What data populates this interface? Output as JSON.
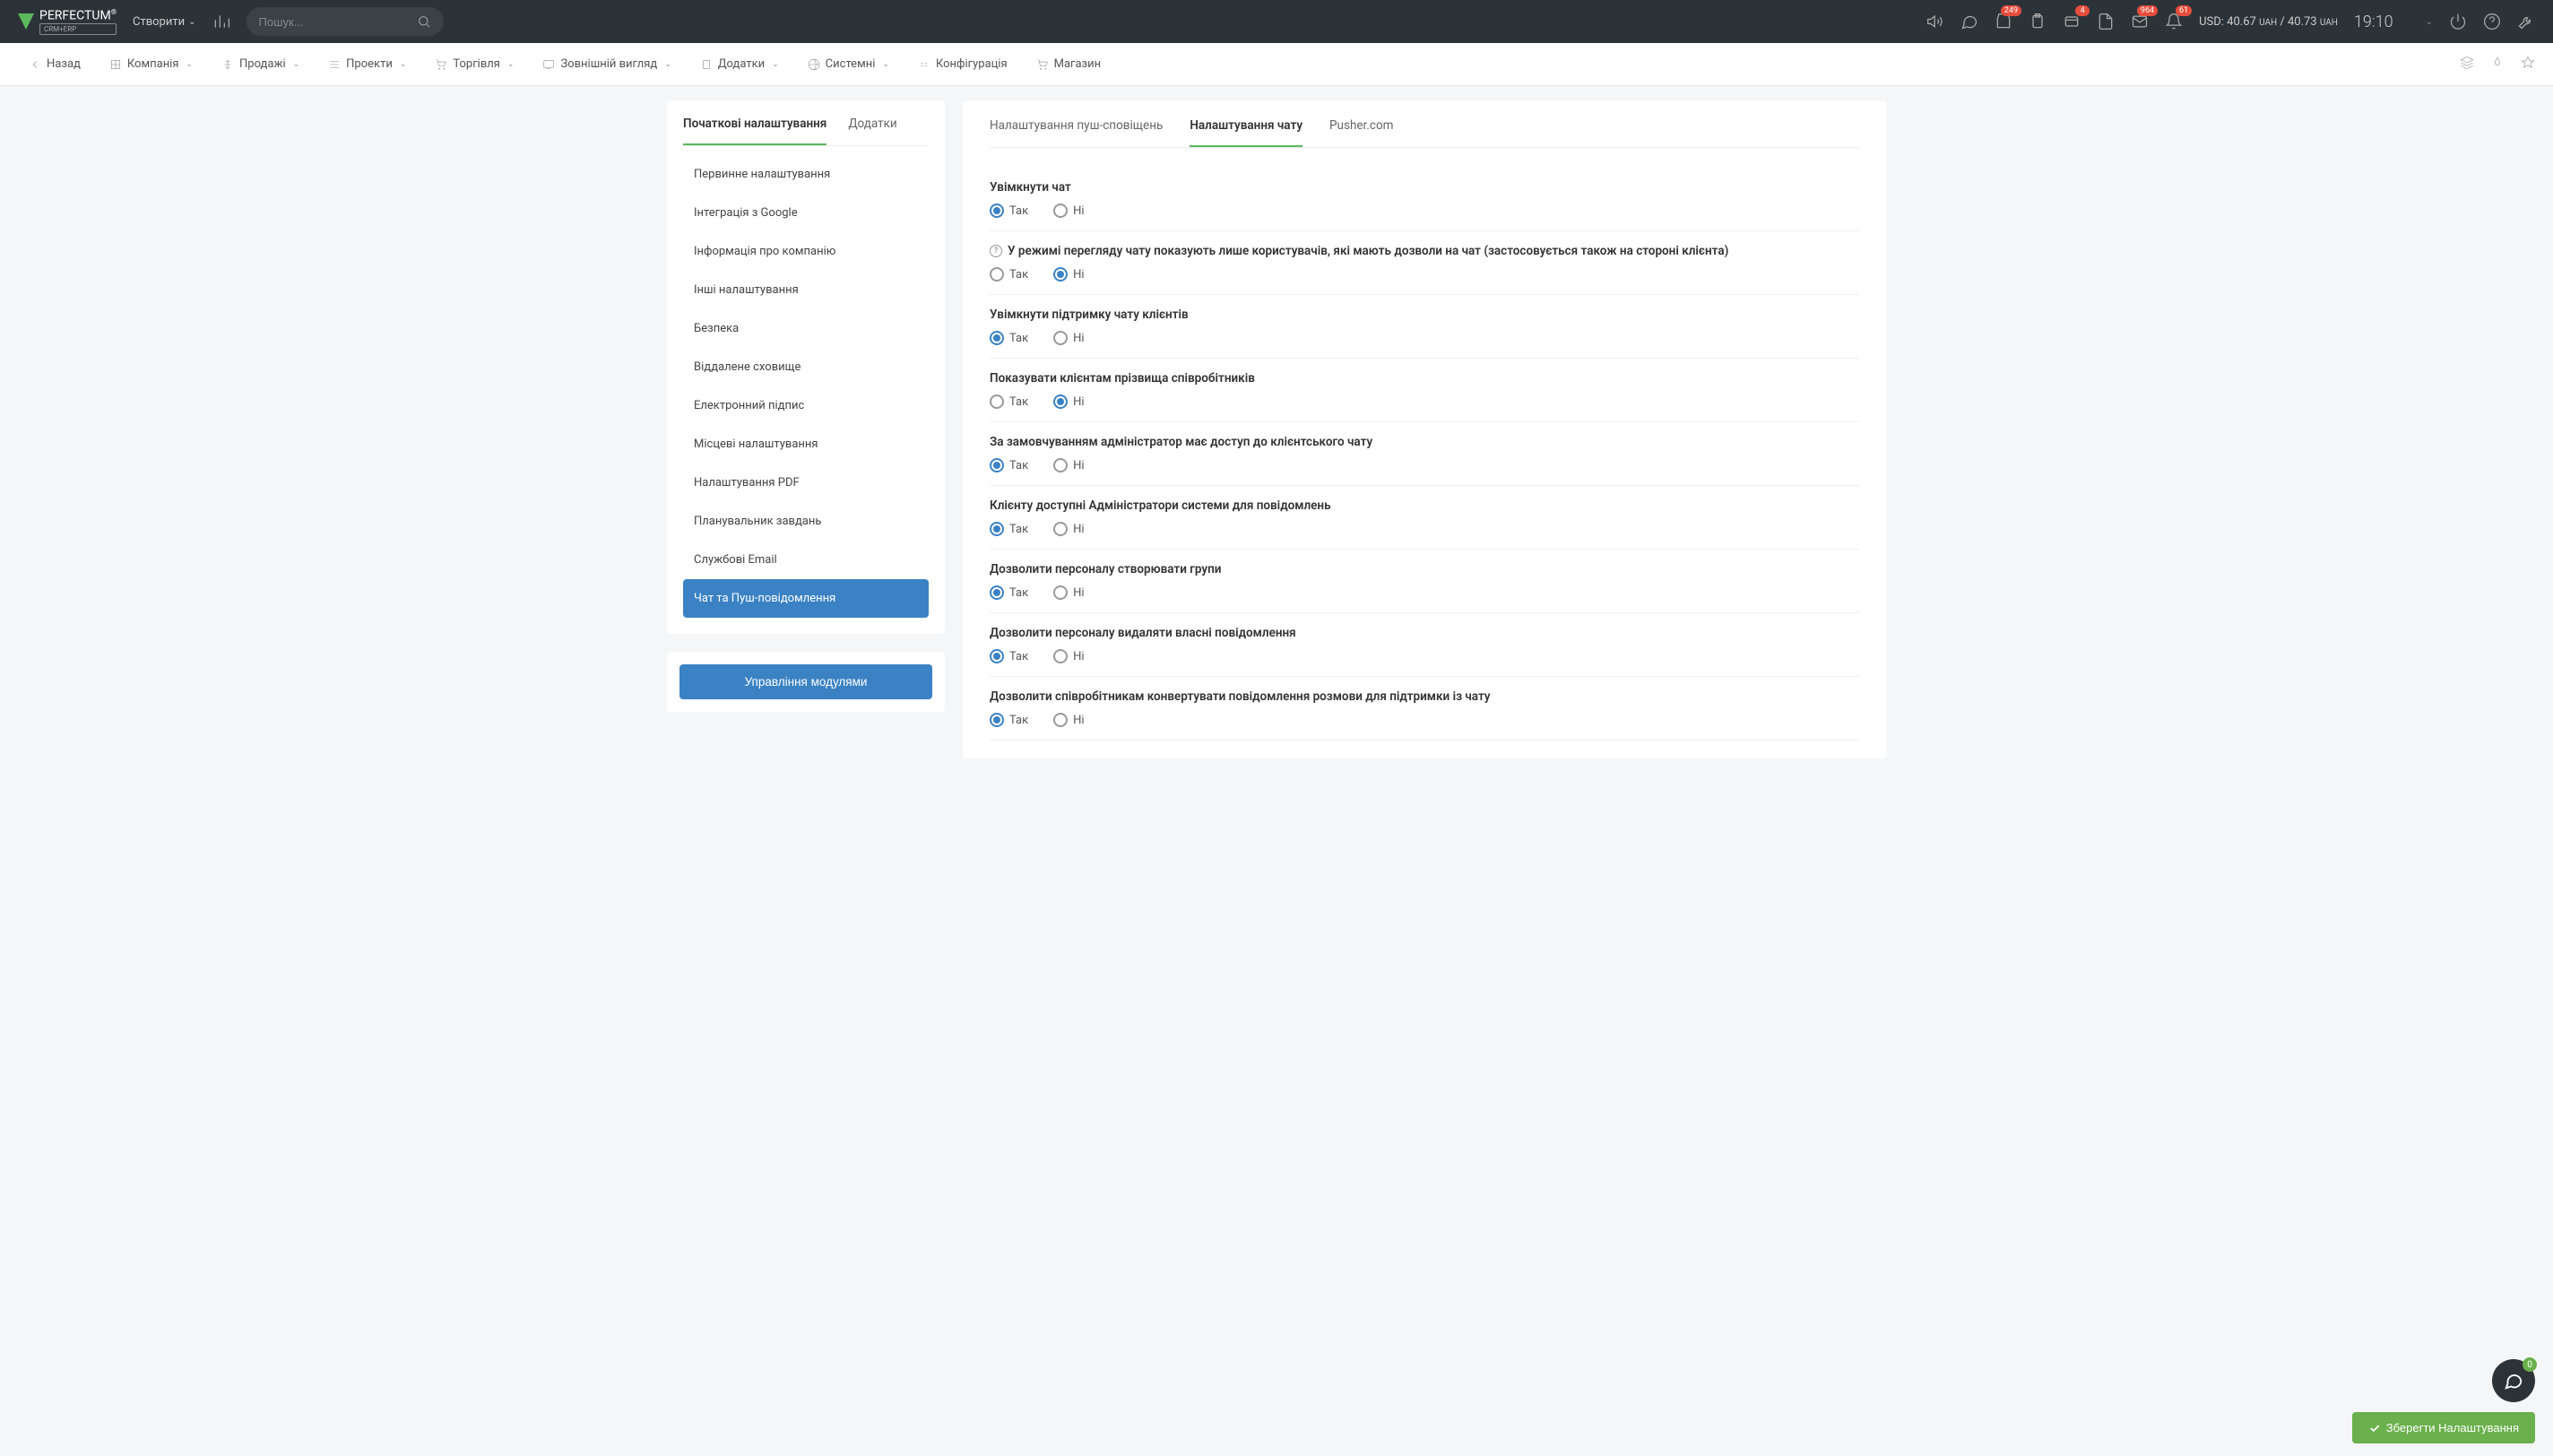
{
  "header": {
    "logo_text": "PERFECTUM",
    "logo_sup": "®",
    "logo_badge": "CRM+ERP",
    "create_label": "Створити",
    "search_placeholder": "Пошук...",
    "badges": {
      "inbox": "249",
      "messages": "4",
      "mail": "964",
      "bell": "61"
    },
    "currency_prefix": "USD:",
    "currency_rate1": "40.67",
    "currency_unit": "UAH",
    "currency_sep": "/",
    "currency_rate2": "40.73",
    "time": "19:10",
    "chat_badge": "0"
  },
  "nav": {
    "back": "Назад",
    "company": "Компанія",
    "sales": "Продажі",
    "projects": "Проекти",
    "trade": "Торгівля",
    "appearance": "Зовнішній вигляд",
    "addons": "Додатки",
    "system": "Системні",
    "config": "Конфігурація",
    "store": "Магазин"
  },
  "sidebar": {
    "tab_initial": "Початкові налаштування",
    "tab_addons": "Додатки",
    "items": [
      "Первинне налаштування",
      "Інтеграція з Google",
      "Інформація про компанію",
      "Інші налаштування",
      "Безпека",
      "Віддалене сховище",
      "Електронний підпис",
      "Місцеві налаштування",
      "Налаштування PDF",
      "Планувальник завдань",
      "Службові Email",
      "Чат та Пуш-повідомлення"
    ],
    "modules_btn": "Управління модулями"
  },
  "content": {
    "tabs": {
      "push": "Налаштування пуш-сповіщень",
      "chat": "Налаштування чату",
      "pusher": "Pusher.com"
    },
    "yes": "Так",
    "no": "Ні",
    "settings": [
      {
        "label": "Увімкнути чат",
        "value": "yes",
        "help": false
      },
      {
        "label": "У режимі перегляду чату показують лише користувачів, які мають дозволи на чат (застосовується також на стороні клієнта)",
        "value": "no",
        "help": true
      },
      {
        "label": "Увімкнути підтримку чату клієнтів",
        "value": "yes",
        "help": false
      },
      {
        "label": "Показувати клієнтам прізвища співробітників",
        "value": "no",
        "help": false
      },
      {
        "label": "За замовчуванням адміністратор має доступ до клієнтського чату",
        "value": "yes",
        "help": false
      },
      {
        "label": "Клієнту доступні Адміністратори системи для повідомлень",
        "value": "yes",
        "help": false
      },
      {
        "label": "Дозволити персоналу створювати групи",
        "value": "yes",
        "help": false
      },
      {
        "label": "Дозволити персоналу видаляти власні повідомлення",
        "value": "yes",
        "help": false
      },
      {
        "label": "Дозволити співробітникам конвертувати повідомлення розмови для підтримки із чату",
        "value": "yes",
        "help": false
      }
    ]
  },
  "save_button": "Зберегти Налаштування"
}
